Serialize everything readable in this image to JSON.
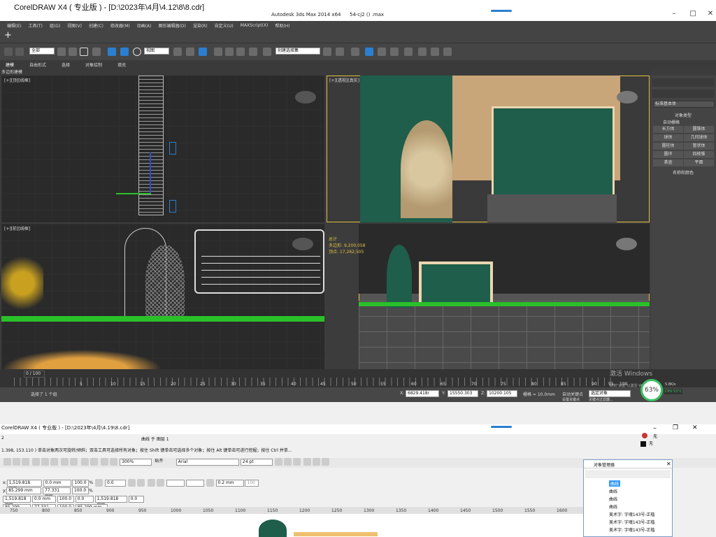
{
  "overlay_window_title": "CorelDRAW X4 ( 专业版 ) - [D:\\2023年\\4月\\4.12\\8\\8.cdr]",
  "max": {
    "app_title": "Autodesk 3ds Max  2014 x64",
    "file_title": "54-cj2  ()  .max",
    "menus": [
      "编辑(E)",
      "工具(T)",
      "组(G)",
      "视图(V)",
      "创建(C)",
      "修改器(M)",
      "动画(A)",
      "图形编辑器(D)",
      "渲染(R)",
      "自定义(U)",
      "MAXScript(X)",
      "帮助(H)"
    ],
    "selection_filter": "全部",
    "view_dropdown": "视图",
    "named_selection": "创建选择集",
    "ribbon_tabs": [
      "建模",
      "自由形式",
      "选择",
      "对象绘制",
      "填充"
    ],
    "ribbon_sub": "多边形建模",
    "viewports": {
      "top_left": "[+][顶][线框]",
      "top_right": "[+][透视][真实]",
      "bottom_left": "[+][前][线框]",
      "bottom_right": "[+][透视][真实 + 边面]"
    },
    "stats": {
      "label": "总计",
      "polys_label": "多边形:",
      "polys": "9,200,058",
      "verts_label": "顶点:",
      "verts": "17,262,505"
    },
    "cmd_panel": {
      "dropdown": "标准基本体",
      "section_title": "对象类型",
      "autogrid": "自动栅格",
      "buttons": [
        "长方体",
        "圆锥体",
        "球体",
        "几何球体",
        "圆柱体",
        "管状体",
        "圆环",
        "四棱锥",
        "茶壶",
        "平面"
      ],
      "name_color": "名称和颜色"
    },
    "timeline": {
      "frame": "0 / 100",
      "ticks": [
        "5",
        "10",
        "15",
        "20",
        "25",
        "30",
        "35",
        "40",
        "45",
        "50",
        "55",
        "60",
        "65",
        "70",
        "75",
        "80",
        "85",
        "90",
        "95",
        "100"
      ]
    },
    "status": {
      "selected": "选择了 1 个组",
      "x_label": "X:",
      "x": "6829.418r",
      "y_label": "Y:",
      "y": "15550.303",
      "z_label": "Z:",
      "z": "10200.105",
      "grid": "栅格 = 10.0mm",
      "autokey": "自动关键点",
      "selected_obj": "选定对象",
      "setkey": "设置关键点",
      "keyfilter": "关键点过滤器..."
    },
    "watermark": [
      "激活 Windows",
      "转到\"设置\"以激活 Windows。"
    ],
    "perf": {
      "percent": "63%",
      "net": "5.8K/s",
      "cpu": "CPU 53°C"
    }
  },
  "cdr": {
    "title": "CorelDRAW X4 ( 专业版 ) - [D:\\2023年\\4月\\4.19\\8.cdr]",
    "page_label": "曲线 于 图层 1",
    "left_code": "2",
    "fill_label": "无",
    "outline_label": "无",
    "hint": "1.398, 153.110 ) 单击对象两次可旋转/倾斜；双击工具可选择所有对象；按住 Shift 键单击可选择多个对象；按住 Alt 键单击可进行挖掘；按住 Ctrl 并单...",
    "zoom": "300%",
    "paste_label": "贴齐",
    "font": "Arial",
    "font_size": "24 pt",
    "x1": "1,519.818 mm",
    "y1": "85.299 mm",
    "w1": "0.0 mm",
    "h1": "77.331 mm",
    "sx": "100.0",
    "sy": "100.0",
    "pct": "%",
    "rot": "0.0",
    "outline_w": "0.2 mm",
    "outline_pct": "100",
    "x2": "1,519.818 mm",
    "y2": "85.299 mm",
    "w2": "0.0 mm",
    "h2": "77.331 mm",
    "sx2": "100.0",
    "sy2": "100.0",
    "rot2": "0.0",
    "x3": "1,519.818 mm",
    "y3": "85.299 mm",
    "rot3": "0.0",
    "ruler": [
      "750",
      "800",
      "850",
      "900",
      "950",
      "1000",
      "1050",
      "1100",
      "1150",
      "1200",
      "1250",
      "1300",
      "1350",
      "1400",
      "1450",
      "1500",
      "1550",
      "1600"
    ],
    "objmgr": {
      "title": "对象管理器",
      "items": [
        "曲线",
        "曲线",
        "曲线",
        "曲线"
      ],
      "text_items": [
        "美术字: 字魂143号-正楷",
        "美术字: 字魂143号-正楷",
        "美术字: 字魂143号-正楷"
      ]
    }
  },
  "colors": {
    "max_bg": "#3c3c3c",
    "viewport_bg": "#2a2a2a",
    "selection": "#e0c040",
    "green_panel": "#1e5e4a",
    "cdr_bg": "#f0f0f0"
  }
}
